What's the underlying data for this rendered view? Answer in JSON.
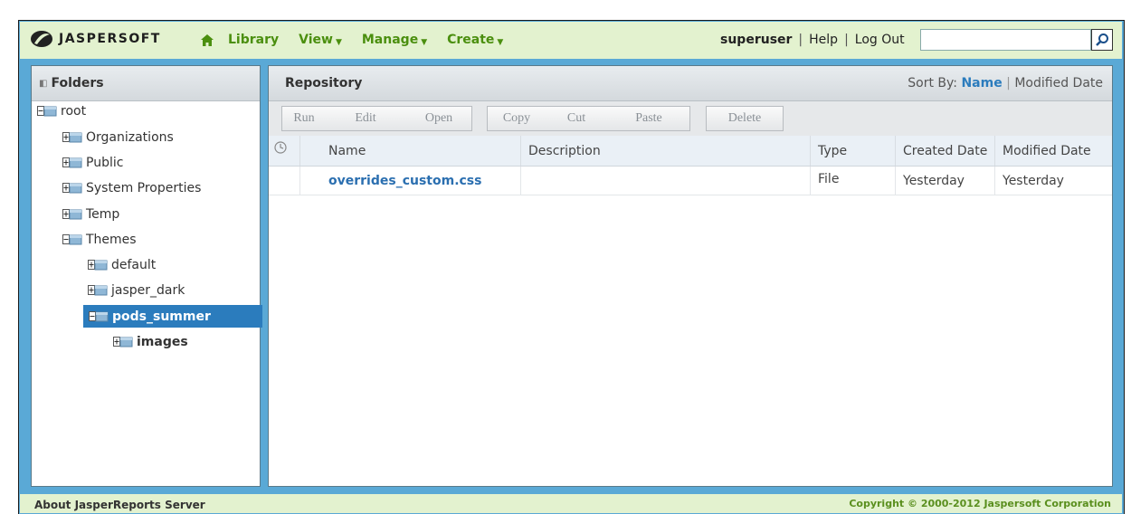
{
  "header": {
    "logo_text": "JASPERSOFT",
    "nav": [
      {
        "label": "Library",
        "dropdown": false
      },
      {
        "label": "View",
        "dropdown": true
      },
      {
        "label": "Manage",
        "dropdown": true
      },
      {
        "label": "Create",
        "dropdown": true
      }
    ],
    "user": "superuser",
    "help": "Help",
    "logout": "Log Out",
    "search_value": ""
  },
  "folders": {
    "title": "Folders",
    "items": [
      {
        "label": "root",
        "level": 0,
        "expanded": true,
        "selected": false
      },
      {
        "label": "Organizations",
        "level": 1,
        "expanded": false,
        "selected": false
      },
      {
        "label": "Public",
        "level": 1,
        "expanded": false,
        "selected": false
      },
      {
        "label": "System Properties",
        "level": 1,
        "expanded": false,
        "selected": false
      },
      {
        "label": "Temp",
        "level": 1,
        "expanded": false,
        "selected": false
      },
      {
        "label": "Themes",
        "level": 1,
        "expanded": true,
        "selected": false
      },
      {
        "label": "default",
        "level": 2,
        "expanded": false,
        "selected": false
      },
      {
        "label": "jasper_dark",
        "level": 2,
        "expanded": false,
        "selected": false
      },
      {
        "label": "pods_summer",
        "level": 2,
        "expanded": true,
        "selected": true
      },
      {
        "label": "images",
        "level": 3,
        "expanded": false,
        "selected": false,
        "bold": true
      }
    ]
  },
  "repository": {
    "title": "Repository",
    "sort_label": "Sort By:",
    "sort_active": "Name",
    "sort_other": "Modified Date",
    "toolbar": {
      "run": "Run",
      "edit": "Edit",
      "open": "Open",
      "copy": "Copy",
      "cut": "Cut",
      "paste": "Paste",
      "delete": "Delete"
    },
    "columns": {
      "name": "Name",
      "description": "Description",
      "type": "Type",
      "created": "Created Date",
      "modified": "Modified Date"
    },
    "rows": [
      {
        "name": "overrides_custom.css",
        "description": "",
        "type": "File",
        "created": "Yesterday",
        "modified": "Yesterday"
      }
    ]
  },
  "footer": {
    "about": "About JasperReports Server",
    "copyright": "Copyright © 2000-2012 Jaspersoft Corporation"
  },
  "colors": {
    "accent": "#4b8f0f",
    "selection": "#2b7cbd",
    "frame": "#5aa9d6",
    "bar": "#e3f2cf"
  }
}
